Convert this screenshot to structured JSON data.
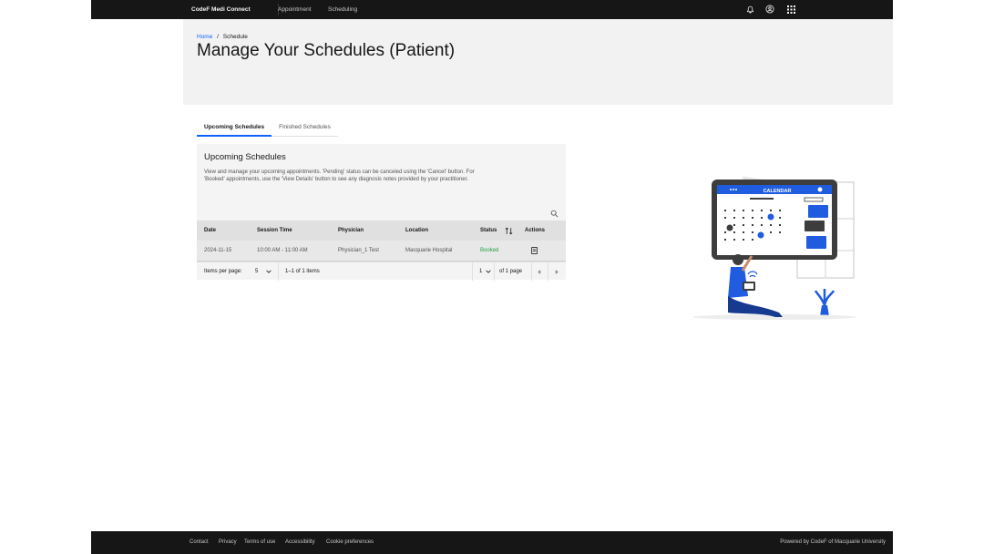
{
  "nav": {
    "brand": "CodeF Medi Connect",
    "links": [
      "Appointment",
      "Scheduling"
    ],
    "icons": [
      "notification-icon",
      "user-avatar-icon",
      "app-switcher-icon"
    ]
  },
  "breadcrumb": {
    "home": "Home",
    "separator": "/",
    "current": "Schedule"
  },
  "page_title": "Manage Your Schedules (Patient)",
  "tabs": [
    {
      "label": "Upcoming Schedules",
      "active": true
    },
    {
      "label": "Finished Schedules",
      "active": false
    }
  ],
  "card": {
    "title": "Upcoming Schedules",
    "description": "View and manage your upcoming appointments. 'Pending' status can be canceled using the 'Cancel' button. For 'Booked' appointments, use the 'View Details' button to see any diagnosis notes provided by your practitioner."
  },
  "table": {
    "headers": [
      "Date",
      "Session Time",
      "Physician",
      "Location",
      "Status",
      "Actions"
    ],
    "rows": [
      {
        "date": "2024-11-15",
        "time": "10:00 AM - 11:00 AM",
        "physician": "Physician_1 Test",
        "location": "Macquarie Hospital",
        "status": "Booked"
      }
    ]
  },
  "pagination": {
    "items_per_page_label": "Items per page:",
    "items_per_page_value": "5",
    "range": "1–1 of 1 items",
    "page_value": "1",
    "page_total": "of 1 page"
  },
  "illustration": {
    "calendar_label": "CALENDAR"
  },
  "footer": {
    "links": [
      "Contact",
      "Privacy",
      "Terms of use",
      "Accessibility",
      "Cookie preferences"
    ],
    "powered_by": "Powered by CodeF of Macquarie University"
  },
  "colors": {
    "accent": "#0f62fe",
    "success": "#24a148",
    "nav_bg": "#161616"
  }
}
